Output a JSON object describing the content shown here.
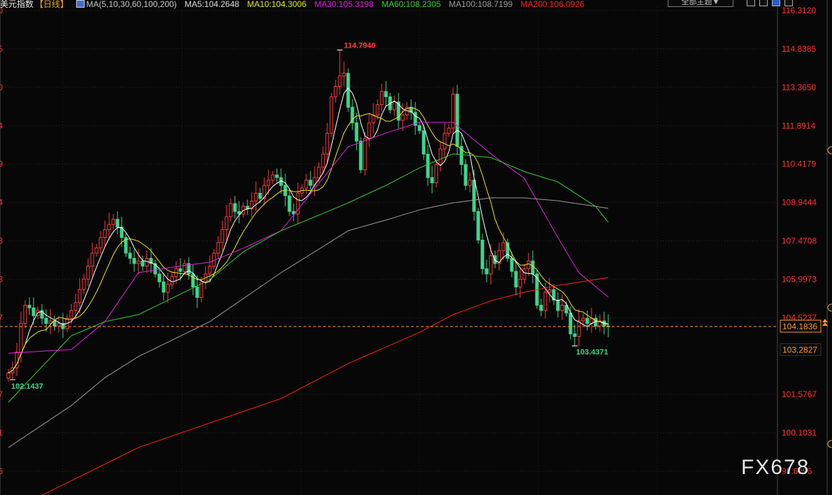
{
  "header": {
    "title": "美元指数",
    "period": "【日线】",
    "ma_params": "MA(5,10,30,60,100,200)",
    "ma5": "MA5:104.2648",
    "ma10": "MA10:104.3006",
    "ma30": "MA30:105.3198",
    "ma60": "MA60:108.2305",
    "ma100": "MA100:108.7199",
    "ma200": "MA200:106.0926",
    "theme_button": "全部主题▼"
  },
  "watermark": "FX678",
  "colors": {
    "up": "#ff3b3b",
    "down": "#3dd68c",
    "ma5": "#ffffff",
    "ma10": "#e8e81e",
    "ma30": "#e020e0",
    "ma60": "#30d030",
    "ma100": "#9a9a9a",
    "ma200": "#ff2020",
    "axis_label": "#ff3030",
    "current": "#ff9a1e"
  },
  "chart_data": {
    "type": "candlestick",
    "title": "美元指数【日线】",
    "ylim": [
      98.6296,
      116.312
    ],
    "y_ticks": [
      "116.3120",
      "114.8385",
      "113.3650",
      "111.8914",
      "110.4179",
      "108.9444",
      "107.4708",
      "105.9973",
      "104.5237",
      "101.5767",
      "100.1031",
      "98.6296"
    ],
    "closes": [
      102.4,
      102.6,
      103.2,
      104.3,
      105.0,
      104.9,
      104.6,
      104.8,
      104.5,
      104.3,
      104.4,
      104.2,
      104.3,
      104.1,
      104.5,
      104.8,
      105.1,
      105.6,
      106.0,
      106.5,
      107.0,
      107.2,
      107.6,
      107.9,
      108.1,
      108.3,
      108.0,
      107.6,
      107.0,
      106.8,
      106.6,
      106.7,
      106.5,
      106.8,
      106.6,
      106.2,
      105.9,
      105.5,
      105.8,
      106.1,
      106.4,
      106.3,
      106.6,
      106.2,
      105.7,
      105.3,
      105.9,
      106.2,
      106.5,
      107.0,
      107.4,
      107.9,
      108.4,
      108.9,
      108.6,
      108.5,
      108.8,
      108.7,
      109.0,
      109.3,
      109.1,
      109.6,
      109.8,
      110.0,
      109.9,
      109.6,
      109.2,
      108.6,
      108.5,
      109.3,
      109.5,
      109.8,
      109.6,
      109.9,
      110.3,
      110.8,
      111.6,
      113.0,
      113.4,
      113.8,
      113.9,
      112.6,
      112.0,
      111.3,
      110.2,
      111.4,
      112.0,
      112.3,
      112.7,
      113.2,
      113.0,
      112.5,
      112.8,
      112.1,
      112.3,
      112.6,
      112.4,
      111.9,
      111.7,
      110.8,
      109.9,
      109.7,
      110.4,
      111.0,
      111.6,
      111.8,
      113.1,
      111.1,
      110.4,
      109.6,
      109.8,
      108.6,
      107.5,
      106.4,
      106.2,
      106.9,
      106.6,
      107.1,
      107.4,
      106.8,
      106.3,
      105.7,
      106.0,
      106.4,
      106.7,
      106.2,
      105.0,
      104.8,
      105.5,
      105.6,
      105.2,
      104.8,
      105.0,
      104.7,
      103.9,
      103.8,
      104.4,
      104.5,
      104.3,
      104.5,
      104.2,
      104.4,
      104.2,
      104.18
    ],
    "first_open": 102.2,
    "ma_series": [
      {
        "name": "MA30",
        "points": [
          [
            0,
            103.16
          ],
          [
            15,
            103.3
          ],
          [
            23,
            104.37
          ],
          [
            31,
            106.25
          ],
          [
            41,
            106.51
          ],
          [
            48,
            106.65
          ],
          [
            56,
            107.19
          ],
          [
            65,
            107.86
          ],
          [
            73,
            109.47
          ],
          [
            81,
            111.08
          ],
          [
            90,
            111.61
          ],
          [
            98,
            112.02
          ],
          [
            106,
            112.02
          ],
          [
            115,
            110.81
          ],
          [
            123,
            109.87
          ],
          [
            131,
            107.59
          ],
          [
            136,
            106.25
          ],
          [
            143,
            105.31
          ]
        ]
      },
      {
        "name": "MA60",
        "points": [
          [
            0,
            101.28
          ],
          [
            15,
            103.83
          ],
          [
            23,
            104.37
          ],
          [
            31,
            104.64
          ],
          [
            48,
            105.98
          ],
          [
            56,
            107.05
          ],
          [
            65,
            107.86
          ],
          [
            73,
            108.39
          ],
          [
            81,
            108.93
          ],
          [
            90,
            109.6
          ],
          [
            98,
            110.27
          ],
          [
            106,
            110.81
          ],
          [
            115,
            110.67
          ],
          [
            123,
            110.13
          ],
          [
            131,
            109.73
          ],
          [
            140,
            108.79
          ],
          [
            143,
            108.18
          ]
        ]
      },
      {
        "name": "MA100",
        "points": [
          [
            0,
            99.54
          ],
          [
            15,
            101.15
          ],
          [
            23,
            102.22
          ],
          [
            31,
            103.03
          ],
          [
            48,
            104.37
          ],
          [
            65,
            106.25
          ],
          [
            73,
            107.05
          ],
          [
            81,
            107.86
          ],
          [
            90,
            108.27
          ],
          [
            98,
            108.66
          ],
          [
            106,
            108.93
          ],
          [
            115,
            109.12
          ],
          [
            123,
            109.12
          ],
          [
            131,
            109.01
          ],
          [
            143,
            108.72
          ]
        ]
      },
      {
        "name": "MA200",
        "points": [
          [
            8,
            97.71
          ],
          [
            31,
            99.54
          ],
          [
            48,
            100.48
          ],
          [
            65,
            101.42
          ],
          [
            81,
            102.76
          ],
          [
            98,
            103.96
          ],
          [
            106,
            104.64
          ],
          [
            115,
            105.17
          ],
          [
            123,
            105.5
          ],
          [
            131,
            105.76
          ],
          [
            143,
            106.06
          ]
        ]
      }
    ],
    "annotations": {
      "high": "114.7940",
      "high_value": 114.794,
      "high_index": 79,
      "low": "102.1437",
      "low_value": 102.1437,
      "low_index": 1,
      "recent_low": "103.4371",
      "recent_low_value": 103.4371,
      "recent_low_index": 135
    },
    "current_price": "104.1836",
    "current_value": 104.1836,
    "marker_price": "103.2827"
  }
}
